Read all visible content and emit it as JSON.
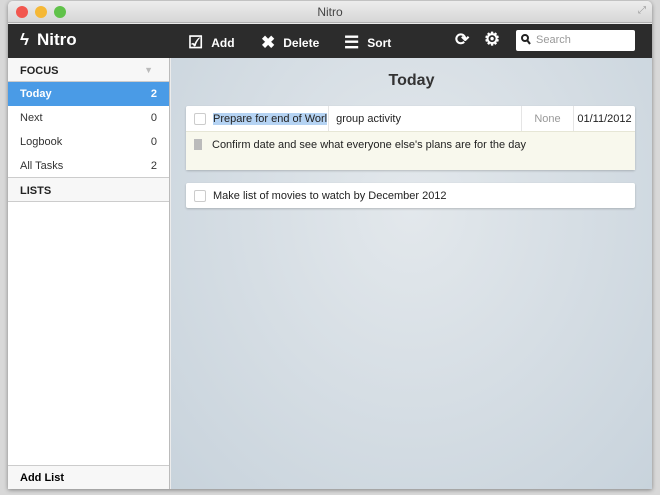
{
  "window": {
    "title": "Nitro"
  },
  "toolbar": {
    "logo": "Nitro",
    "add": "Add",
    "delete": "Delete",
    "sort": "Sort",
    "search_placeholder": "Search"
  },
  "sidebar": {
    "focus_header": "FOCUS",
    "items": [
      {
        "label": "Today",
        "count": "2"
      },
      {
        "label": "Next",
        "count": "0"
      },
      {
        "label": "Logbook",
        "count": "0"
      },
      {
        "label": "All Tasks",
        "count": "2"
      }
    ],
    "lists_header": "LISTS",
    "add_list": "Add List"
  },
  "main": {
    "title": "Today",
    "tasks": [
      {
        "title_selected": "Prepare for end of Worl",
        "title_rest": "group activity",
        "priority": "None",
        "date": "01/11/2012",
        "note": "Confirm date and see what everyone else's plans are for the day"
      },
      {
        "title": "Make list of movies to watch by December 2012"
      }
    ]
  }
}
